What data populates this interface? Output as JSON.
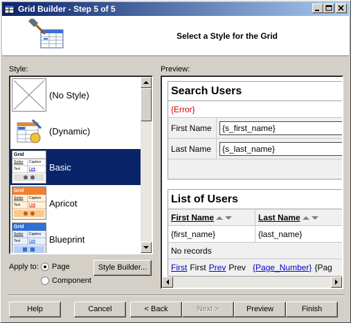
{
  "window": {
    "title": "Grid Builder - Step 5 of 5",
    "controls": {
      "minimize": "minimize",
      "maximize": "maximize",
      "close": "close"
    }
  },
  "header": {
    "heading": "Select a Style for the Grid"
  },
  "style_panel": {
    "label": "Style:",
    "items": [
      {
        "label": "(No Style)",
        "icon": "no-style-thumbnail",
        "selected": false
      },
      {
        "label": "(Dynamic)",
        "icon": "dynamic-style-thumbnail",
        "selected": false
      },
      {
        "label": "Basic",
        "icon": "basic-style-thumbnail",
        "selected": true,
        "thumb": {
          "title": "Grid",
          "col1": "Sorter",
          "col2": "Caption",
          "cell1": "Text",
          "cell2": "Link"
        }
      },
      {
        "label": "Apricot",
        "icon": "apricot-style-thumbnail",
        "selected": false,
        "thumb": {
          "title": "Grid",
          "col1": "Sorter",
          "col2": "Caption",
          "cell1": "Text",
          "cell2": "Link"
        }
      },
      {
        "label": "Blueprint",
        "icon": "blueprint-style-thumbnail",
        "selected": false,
        "thumb": {
          "title": "Grid",
          "col1": "Sorter",
          "col2": "Caption",
          "cell1": "Text",
          "cell2": "Link"
        }
      }
    ]
  },
  "apply_to": {
    "label": "Apply to:",
    "options": [
      {
        "label": "Page",
        "checked": true
      },
      {
        "label": "Component",
        "checked": false
      }
    ]
  },
  "style_builder_button": "Style Builder...",
  "preview": {
    "label": "Preview:",
    "search": {
      "title": "Search Users",
      "error": "{Error}",
      "fields": [
        {
          "label": "First Name",
          "value": "{s_first_name}"
        },
        {
          "label": "Last Name",
          "value": "{s_last_name}"
        }
      ]
    },
    "list": {
      "title": "List of Users",
      "columns": [
        "First Name",
        "Last Name"
      ],
      "row": [
        "{first_name}",
        "{last_name}"
      ],
      "empty": "No records",
      "nav": {
        "first_link": "First",
        "first_text": "First",
        "prev_link": "Prev",
        "prev_text": "Prev",
        "page_number": "{Page_Number}",
        "trailing": "{Pag"
      }
    }
  },
  "footer": {
    "help": "Help",
    "cancel": "Cancel",
    "back": "< Back",
    "next": "Next >",
    "preview": "Preview",
    "finish": "Finish"
  },
  "colors": {
    "selection": "#0a246a",
    "titlebar_start": "#0a246a",
    "titlebar_end": "#a6caf0",
    "error": "#cc0000",
    "link": "#0000cc",
    "apricot": "#f08030",
    "blueprint": "#3070d0"
  }
}
